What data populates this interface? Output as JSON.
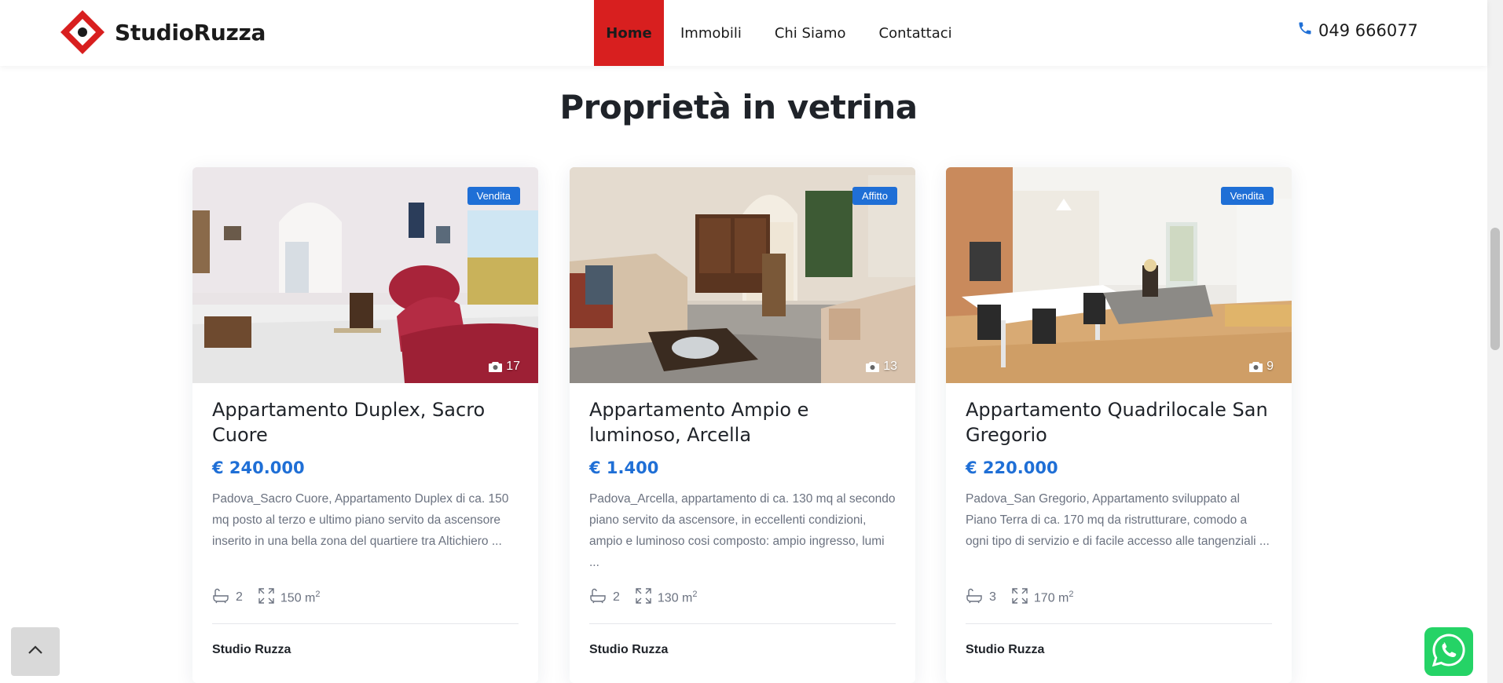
{
  "header": {
    "brand": "StudioRuzza",
    "nav": [
      {
        "label": "Home",
        "active": true
      },
      {
        "label": "Immobili",
        "active": false
      },
      {
        "label": "Chi Siamo",
        "active": false
      },
      {
        "label": "Contattaci",
        "active": false
      }
    ],
    "phone": "049 666077",
    "phone_icon": "phone-icon"
  },
  "section": {
    "title": "Proprietà in vetrina"
  },
  "cards": [
    {
      "badge": "Vendita",
      "photo_count": "17",
      "title": "Appartamento Duplex, Sacro Cuore",
      "price": "€ 240.000",
      "description": "Padova_Sacro Cuore, Appartamento Duplex di ca. 150 mq posto al terzo e ultimo piano servito da ascensore inserito in una bella zona del quartiere tra Altichiero ...",
      "baths": "2",
      "area": "150 m",
      "area_unit_sup": "2",
      "agent": "Studio Ruzza"
    },
    {
      "badge": "Affitto",
      "photo_count": "13",
      "title": "Appartamento Ampio e luminoso, Arcella",
      "price": "€ 1.400",
      "description": "Padova_Arcella, appartamento di ca. 130 mq al secondo piano servito da ascensore, in eccellenti condizioni, ampio e luminoso cosi composto: ampio ingresso, lumi ...",
      "baths": "2",
      "area": "130 m",
      "area_unit_sup": "2",
      "agent": "Studio Ruzza"
    },
    {
      "badge": "Vendita",
      "photo_count": "9",
      "title": "Appartamento Quadrilocale San Gregorio",
      "price": "€ 220.000",
      "description": "Padova_San Gregorio, Appartamento sviluppato al Piano Terra di ca. 170 mq da ristrutturare, comodo a ogni tipo di servizio e di facile accesso alle tangenziali ...",
      "baths": "3",
      "area": "170 m",
      "area_unit_sup": "2",
      "agent": "Studio Ruzza"
    }
  ],
  "colors": {
    "brand_red": "#d81f1f",
    "accent_blue": "#1f6fd6",
    "whatsapp_green": "#25d366"
  }
}
